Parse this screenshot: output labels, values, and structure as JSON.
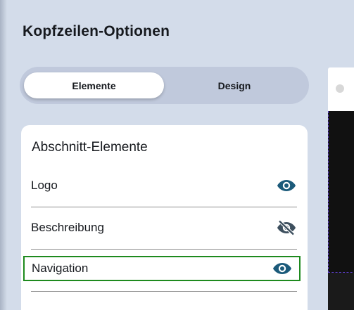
{
  "panel": {
    "title": "Kopfzeilen-Optionen"
  },
  "tabs": [
    {
      "label": "Elemente",
      "active": true
    },
    {
      "label": "Design",
      "active": false
    }
  ],
  "section": {
    "title": "Abschnitt-Elemente",
    "items": [
      {
        "label": "Logo",
        "visibility_icon": "eye-icon"
      },
      {
        "label": "Beschreibung",
        "visibility_icon": "eye-off-icon"
      },
      {
        "label": "Navigation",
        "visibility_icon": "eye-icon"
      }
    ]
  },
  "colors": {
    "background": "#d3dcea",
    "icon": "#1b5a7a",
    "icon_muted": "#3d4f5e",
    "selection_outline": "#1e8a1e"
  }
}
